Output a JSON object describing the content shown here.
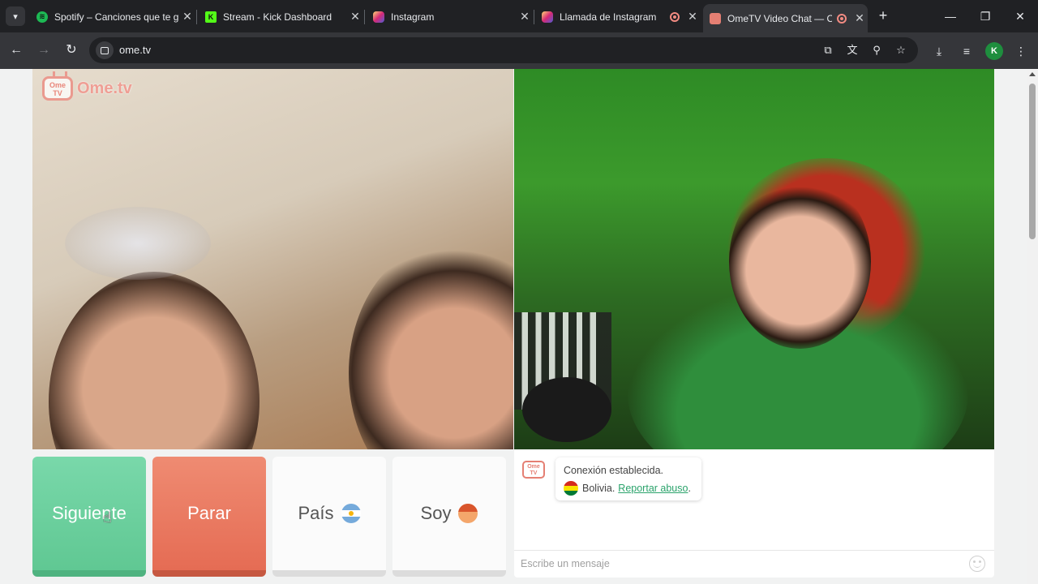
{
  "browser": {
    "tabs": [
      {
        "title": "Spotify – Canciones que te g",
        "icon": "spotify-icon",
        "color": "#1db954"
      },
      {
        "title": "Stream - Kick Dashboard",
        "icon": "kick-icon",
        "color": "#53fc18"
      },
      {
        "title": "Instagram",
        "icon": "instagram-icon",
        "color": "#e1306c"
      },
      {
        "title": "Llamada de Instagram",
        "icon": "instagram-icon",
        "color": "#e1306c"
      },
      {
        "title": "OmeTV Video Chat — O",
        "icon": "ometv-icon",
        "color": "#e57f73",
        "active": true
      }
    ],
    "new_tab_glyph": "+",
    "close_glyph": "✕",
    "url": "ome.tv",
    "profile_initial": "K"
  },
  "page": {
    "brand": {
      "badge": "Ome TV",
      "name": "Ome.tv"
    },
    "buttons": {
      "next": "Siguiente",
      "stop": "Parar",
      "country": "País",
      "gender": "Soy"
    },
    "chat": {
      "logo_badge": "Ome TV",
      "status": "Conexión establecida.",
      "country": "Bolivia.",
      "report": "Reportar abuso",
      "report_suffix": ".",
      "placeholder": "Escribe un mensaje"
    }
  }
}
